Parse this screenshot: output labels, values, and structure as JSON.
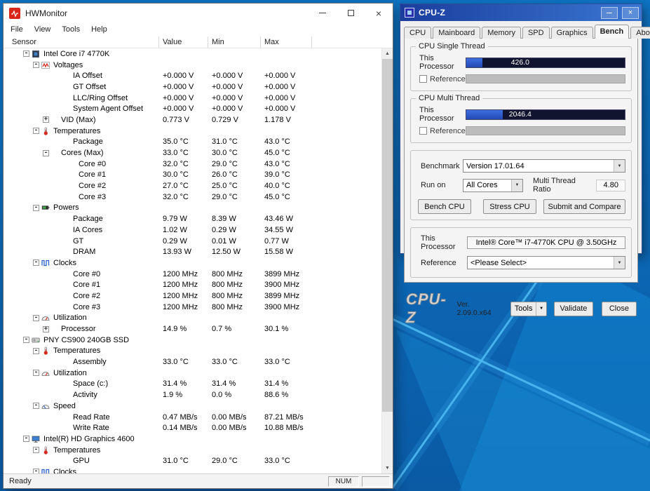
{
  "icons": {
    "close": "×",
    "dropdown": "▼",
    "scroll_up": "▲",
    "scroll_down": "▼"
  },
  "hwmonitor": {
    "title": "HWMonitor",
    "menu": [
      "File",
      "View",
      "Tools",
      "Help"
    ],
    "columns": [
      "Sensor",
      "Value",
      "Min",
      "Max"
    ],
    "status_ready": "Ready",
    "status_num": "NUM",
    "rows": [
      {
        "type": "device",
        "icon": "chip-icon",
        "expander": "-",
        "label": "Intel Core i7 4770K",
        "value": "",
        "min": "",
        "max": ""
      },
      {
        "type": "category",
        "icon": "voltage-icon",
        "expander": "-",
        "label": "Voltages",
        "value": "",
        "min": "",
        "max": ""
      },
      {
        "type": "sensor",
        "label": "IA Offset",
        "value": "+0.000 V",
        "min": "+0.000 V",
        "max": "+0.000 V"
      },
      {
        "type": "sensor",
        "label": "GT Offset",
        "value": "+0.000 V",
        "min": "+0.000 V",
        "max": "+0.000 V"
      },
      {
        "type": "sensor",
        "label": "LLC/Ring Offset",
        "value": "+0.000 V",
        "min": "+0.000 V",
        "max": "+0.000 V"
      },
      {
        "type": "sensor",
        "label": "System Agent Offset",
        "value": "+0.000 V",
        "min": "+0.000 V",
        "max": "+0.000 V"
      },
      {
        "type": "subgroup",
        "expander": "+",
        "label": "VID (Max)",
        "value": "0.773 V",
        "min": "0.729 V",
        "max": "1.178 V"
      },
      {
        "type": "category",
        "icon": "temp-icon",
        "expander": "-",
        "label": "Temperatures",
        "value": "",
        "min": "",
        "max": ""
      },
      {
        "type": "sensor",
        "label": "Package",
        "value": "35.0 °C",
        "min": "31.0 °C",
        "max": "43.0 °C"
      },
      {
        "type": "subgroup",
        "expander": "-",
        "label": "Cores (Max)",
        "value": "33.0 °C",
        "min": "30.0 °C",
        "max": "45.0 °C"
      },
      {
        "type": "subsensor",
        "label": "Core #0",
        "value": "32.0 °C",
        "min": "29.0 °C",
        "max": "43.0 °C"
      },
      {
        "type": "subsensor",
        "label": "Core #1",
        "value": "30.0 °C",
        "min": "26.0 °C",
        "max": "39.0 °C"
      },
      {
        "type": "subsensor",
        "label": "Core #2",
        "value": "27.0 °C",
        "min": "25.0 °C",
        "max": "40.0 °C"
      },
      {
        "type": "subsensor",
        "label": "Core #3",
        "value": "32.0 °C",
        "min": "29.0 °C",
        "max": "45.0 °C"
      },
      {
        "type": "category",
        "icon": "power-icon",
        "expander": "-",
        "label": "Powers",
        "value": "",
        "min": "",
        "max": ""
      },
      {
        "type": "sensor",
        "label": "Package",
        "value": "9.79 W",
        "min": "8.39 W",
        "max": "43.46 W"
      },
      {
        "type": "sensor",
        "label": "IA Cores",
        "value": "1.02 W",
        "min": "0.29 W",
        "max": "34.55 W"
      },
      {
        "type": "sensor",
        "label": "GT",
        "value": "0.29 W",
        "min": "0.01 W",
        "max": "0.77 W"
      },
      {
        "type": "sensor",
        "label": "DRAM",
        "value": "13.93 W",
        "min": "12.50 W",
        "max": "15.58 W"
      },
      {
        "type": "category",
        "icon": "clock-icon",
        "expander": "-",
        "label": "Clocks",
        "value": "",
        "min": "",
        "max": ""
      },
      {
        "type": "sensor",
        "label": "Core #0",
        "value": "1200 MHz",
        "min": "800 MHz",
        "max": "3899 MHz"
      },
      {
        "type": "sensor",
        "label": "Core #1",
        "value": "1200 MHz",
        "min": "800 MHz",
        "max": "3900 MHz"
      },
      {
        "type": "sensor",
        "label": "Core #2",
        "value": "1200 MHz",
        "min": "800 MHz",
        "max": "3899 MHz"
      },
      {
        "type": "sensor",
        "label": "Core #3",
        "value": "1200 MHz",
        "min": "800 MHz",
        "max": "3900 MHz"
      },
      {
        "type": "category",
        "icon": "util-icon",
        "expander": "-",
        "label": "Utilization",
        "value": "",
        "min": "",
        "max": ""
      },
      {
        "type": "subgroup",
        "expander": "+",
        "label": "Processor",
        "value": "14.9 %",
        "min": "0.7 %",
        "max": "30.1 %"
      },
      {
        "type": "device",
        "icon": "disk-icon",
        "expander": "-",
        "label": "PNY CS900 240GB SSD",
        "value": "",
        "min": "",
        "max": ""
      },
      {
        "type": "category",
        "icon": "temp-icon",
        "expander": "-",
        "label": "Temperatures",
        "value": "",
        "min": "",
        "max": ""
      },
      {
        "type": "sensor",
        "label": "Assembly",
        "value": "33.0 °C",
        "min": "33.0 °C",
        "max": "33.0 °C"
      },
      {
        "type": "category",
        "icon": "util-icon",
        "expander": "-",
        "label": "Utilization",
        "value": "",
        "min": "",
        "max": ""
      },
      {
        "type": "sensor",
        "label": "Space (c:)",
        "value": "31.4 %",
        "min": "31.4 %",
        "max": "31.4 %"
      },
      {
        "type": "sensor",
        "label": "Activity",
        "value": "1.9 %",
        "min": "0.0 %",
        "max": "88.6 %"
      },
      {
        "type": "category",
        "icon": "speed-icon",
        "expander": "-",
        "label": "Speed",
        "value": "",
        "min": "",
        "max": ""
      },
      {
        "type": "sensor",
        "label": "Read Rate",
        "value": "0.47 MB/s",
        "min": "0.00 MB/s",
        "max": "87.21 MB/s"
      },
      {
        "type": "sensor",
        "label": "Write Rate",
        "value": "0.14 MB/s",
        "min": "0.00 MB/s",
        "max": "10.88 MB/s"
      },
      {
        "type": "device",
        "icon": "gpu-icon",
        "expander": "-",
        "label": "Intel(R) HD Graphics 4600",
        "value": "",
        "min": "",
        "max": ""
      },
      {
        "type": "category",
        "icon": "temp-icon",
        "expander": "-",
        "label": "Temperatures",
        "value": "",
        "min": "",
        "max": ""
      },
      {
        "type": "sensor",
        "label": "GPU",
        "value": "31.0 °C",
        "min": "29.0 °C",
        "max": "33.0 °C"
      },
      {
        "type": "category",
        "icon": "clock-icon",
        "expander": "-",
        "label": "Clocks",
        "value": "",
        "min": "",
        "max": ""
      }
    ]
  },
  "cpuz": {
    "title": "CPU-Z",
    "tabs": [
      "CPU",
      "Mainboard",
      "Memory",
      "SPD",
      "Graphics",
      "Bench",
      "About"
    ],
    "active_tab": "Bench",
    "single_thread": {
      "group_label": "CPU Single Thread",
      "processor_label": "This Processor",
      "score": "426.0",
      "fill_pct": 10,
      "reference_label": "Reference"
    },
    "multi_thread": {
      "group_label": "CPU Multi Thread",
      "processor_label": "This Processor",
      "score": "2046.4",
      "fill_pct": 23,
      "reference_label": "Reference"
    },
    "controls": {
      "benchmark_label": "Benchmark",
      "benchmark_value": "Version 17.01.64",
      "run_on_label": "Run on",
      "run_on_value": "All Cores",
      "ratio_label": "Multi Thread Ratio",
      "ratio_value": "4.80",
      "bench_cpu_btn": "Bench CPU",
      "stress_cpu_btn": "Stress CPU",
      "submit_btn": "Submit and Compare"
    },
    "processor": {
      "this_label": "This Processor",
      "this_value": "Intel® Core™ i7-4770K CPU @ 3.50GHz",
      "reference_label": "Reference",
      "reference_value": "<Please Select>"
    },
    "footer": {
      "logo": "CPU-Z",
      "version": "Ver. 2.09.0.x64",
      "tools_btn": "Tools",
      "validate_btn": "Validate",
      "close_btn": "Close"
    },
    "colors": {
      "bar_fill": "#2f5cd0",
      "bar_bg": "#10142e",
      "titlebar": "#2a5cc0"
    }
  }
}
